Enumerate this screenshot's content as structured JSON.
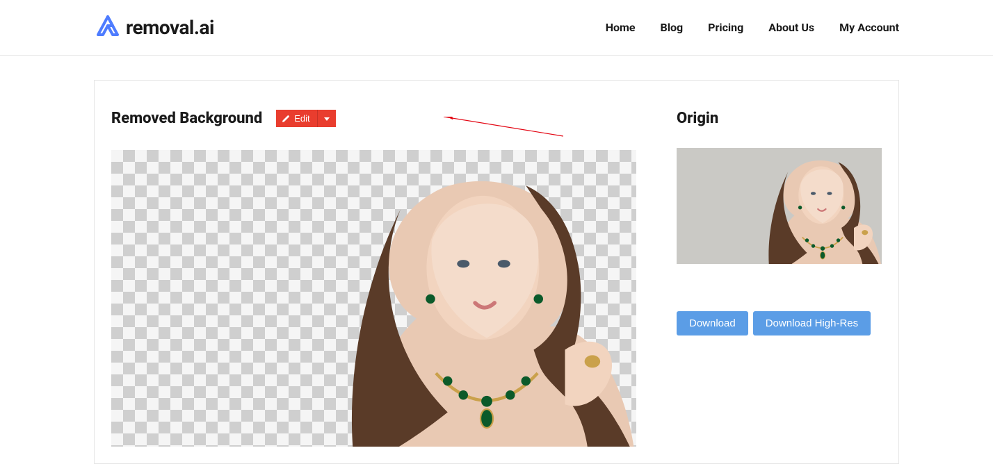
{
  "brand": {
    "name": "removal.ai"
  },
  "nav": {
    "items": [
      {
        "label": "Home"
      },
      {
        "label": "Blog"
      },
      {
        "label": "Pricing"
      },
      {
        "label": "About Us"
      },
      {
        "label": "My Account"
      }
    ]
  },
  "main": {
    "title": "Removed Background",
    "edit_label": "Edit"
  },
  "side": {
    "title": "Origin",
    "download_label": "Download",
    "download_hires_label": "Download High-Res"
  },
  "colors": {
    "accent_red": "#e93d2e",
    "accent_blue": "#5b9de6",
    "logo_blue": "#4e7cff"
  }
}
